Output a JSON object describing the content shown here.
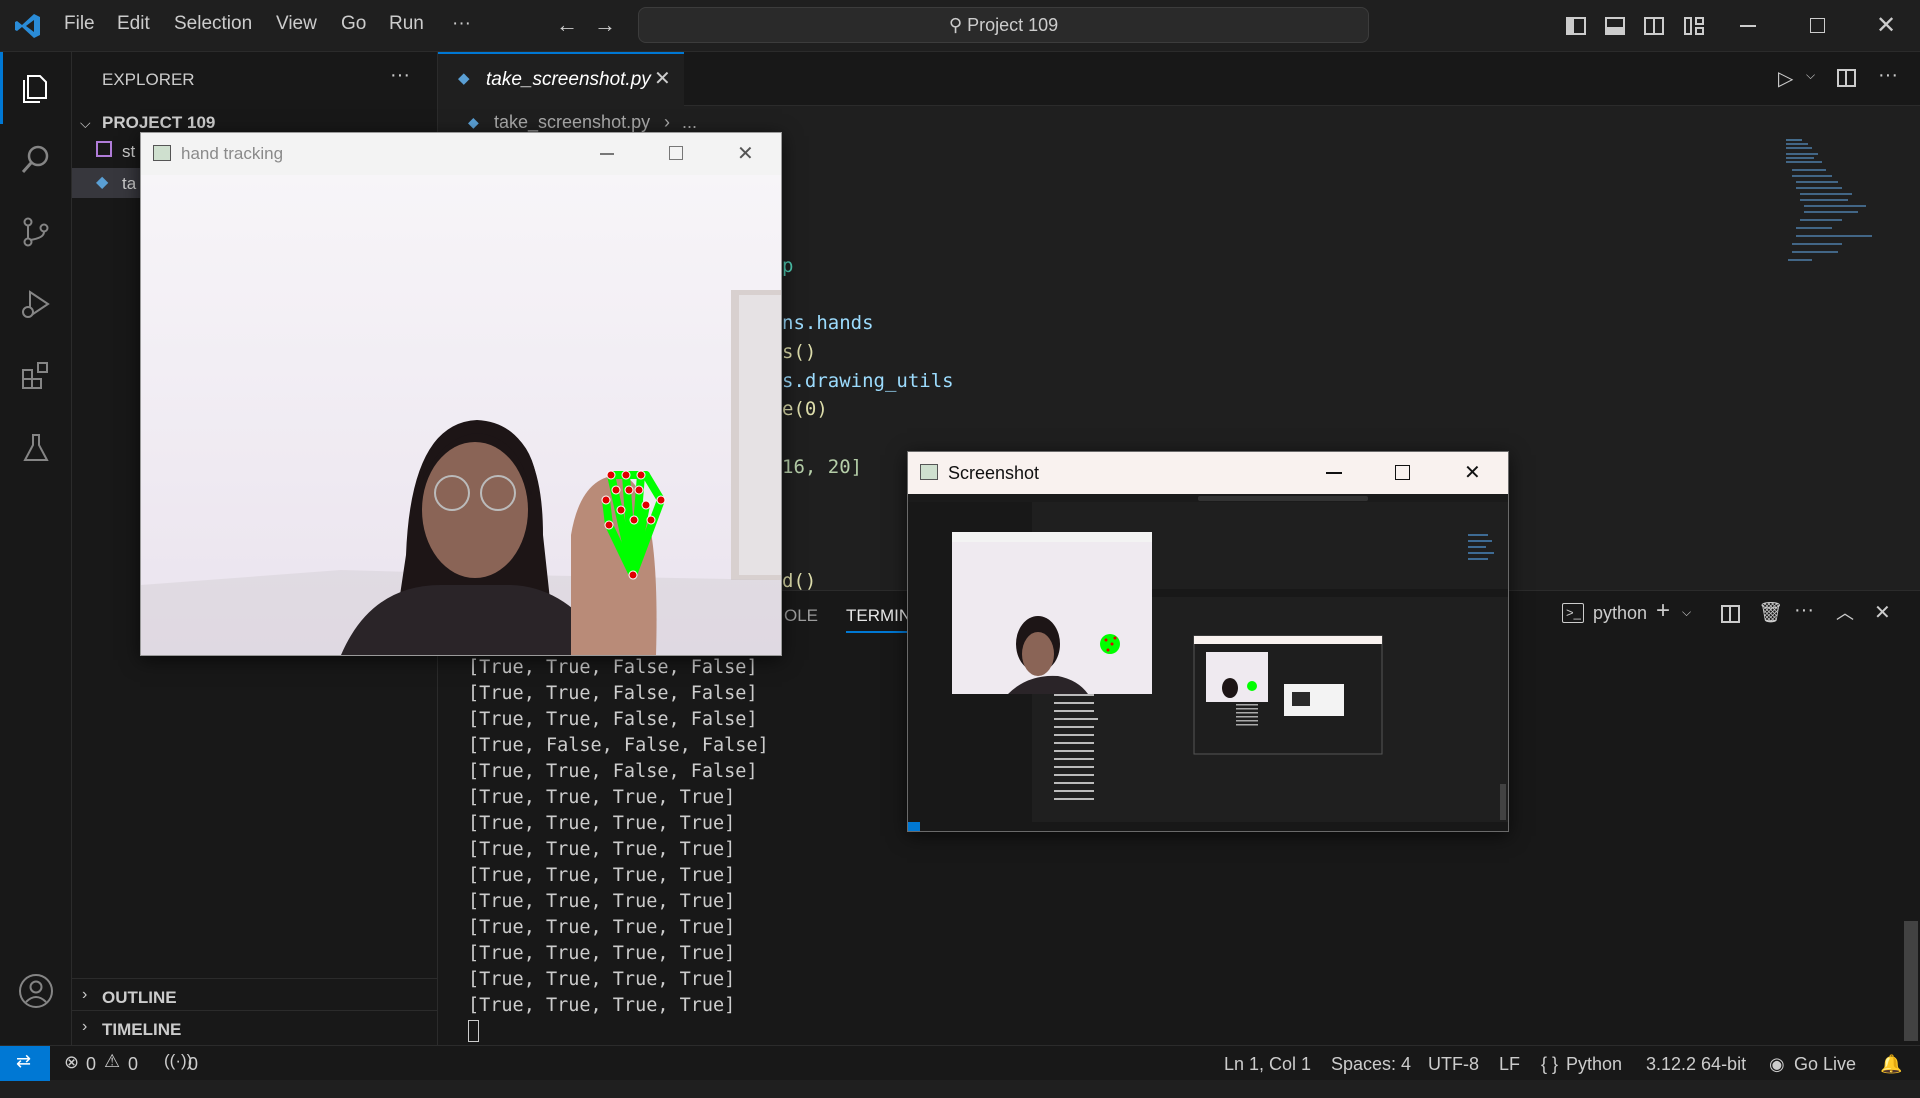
{
  "app": {
    "title": "Project 109"
  },
  "menu": [
    "File",
    "Edit",
    "Selection",
    "View",
    "Go",
    "Run",
    "···"
  ],
  "sidebar": {
    "header": "EXPLORER",
    "project": "PROJECT 109",
    "files": [
      "st",
      "ta"
    ],
    "outline": "OUTLINE",
    "timeline": "TIMELINE"
  },
  "editor": {
    "tab_label": "take_screenshot.py",
    "breadcrumb_file": "take_screenshot.py",
    "breadcrumb_more": "...",
    "code_lines": [
      {
        "text": "p",
        "color": "#4ec9b0"
      },
      {
        "text": "ns.hands",
        "color": "#9cdcfe"
      },
      {
        "text": "s()",
        "color": "#dcdcaa"
      },
      {
        "text": "s.drawing_utils",
        "color": "#9cdcfe"
      },
      {
        "text": "e(0)",
        "color": "#dcdcaa"
      },
      {
        "text": "16, 20]",
        "color": "#b5cea8"
      },
      {
        "text": "d()",
        "color": "#dcdcaa"
      }
    ]
  },
  "panel": {
    "tab_console_partial": "OLE",
    "tab_terminal_partial": "TERMIN",
    "terminal_name": "python",
    "lines": [
      "[True, True, False, False]",
      "[True, True, False, False]",
      "[True, True, False, False]",
      "[True, False, False, False]",
      "[True, True, False, False]",
      "[True, True, True, True]",
      "[True, True, True, True]",
      "[True, True, True, True]",
      "[True, True, True, True]",
      "[True, True, True, True]",
      "[True, True, True, True]",
      "[True, True, True, True]",
      "[True, True, True, True]",
      "[True, True, True, True]"
    ]
  },
  "hand_window": {
    "title": "hand tracking"
  },
  "screenshot_window": {
    "title": "Screenshot"
  },
  "status": {
    "errors": "0",
    "warnings": "0",
    "ports": "0",
    "position": "Ln 1, Col 1",
    "spaces": "Spaces: 4",
    "encoding": "UTF-8",
    "eol": "LF",
    "language": "Python",
    "interpreter": "3.12.2 64-bit",
    "golive": "Go Live"
  },
  "colors": {
    "accent": "#0078d4",
    "bg": "#1f1f1f",
    "hand_landmark": "#00ff00",
    "landmark_dot": "#e00000"
  }
}
